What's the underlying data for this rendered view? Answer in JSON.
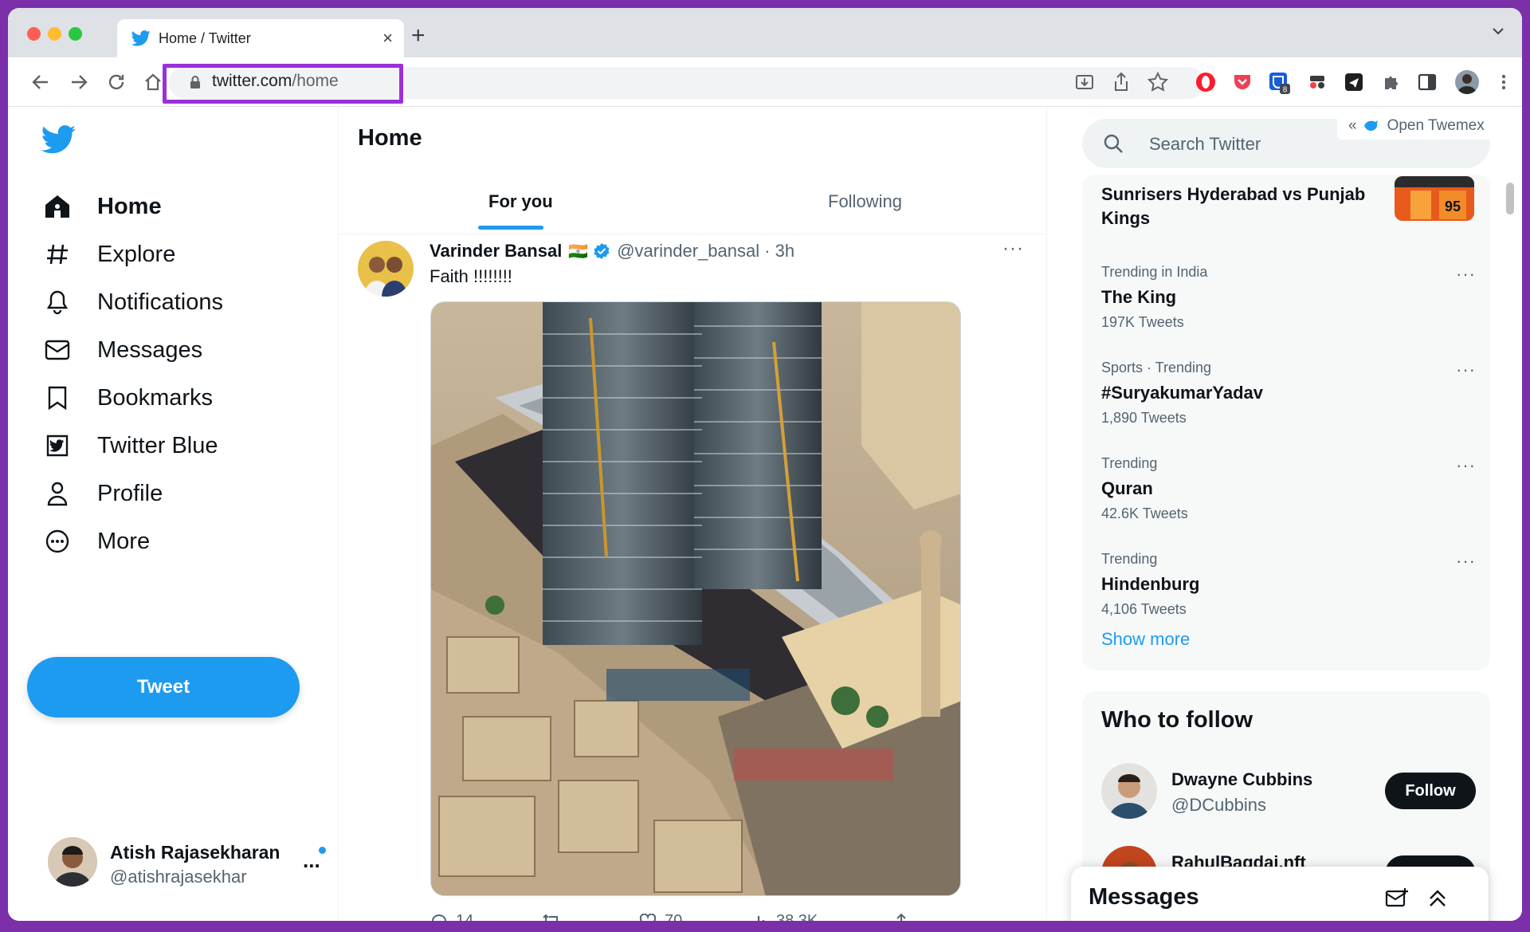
{
  "browser": {
    "tab_title": "Home / Twitter",
    "tab_close": "×",
    "new_tab": "+",
    "url_host": "twitter.com",
    "url_path": "/home",
    "extension_badge": "8"
  },
  "nav": {
    "items": [
      {
        "label": "Home",
        "icon": "home-icon",
        "active": true
      },
      {
        "label": "Explore",
        "icon": "hashtag-icon"
      },
      {
        "label": "Notifications",
        "icon": "bell-icon"
      },
      {
        "label": "Messages",
        "icon": "envelope-icon"
      },
      {
        "label": "Bookmarks",
        "icon": "bookmark-icon"
      },
      {
        "label": "Twitter Blue",
        "icon": "twitter-blue-icon"
      },
      {
        "label": "Profile",
        "icon": "person-icon"
      },
      {
        "label": "More",
        "icon": "more-circle-icon"
      }
    ],
    "tweet_button": "Tweet"
  },
  "account": {
    "name": "Atish Rajasekharan",
    "handle": "@atishrajasekhar",
    "more": "..."
  },
  "main": {
    "title": "Home",
    "tabs": [
      {
        "label": "For you",
        "active": true
      },
      {
        "label": "Following"
      }
    ]
  },
  "tweet": {
    "author": "Varinder Bansal",
    "flag": "🇮🇳",
    "handle_time": "@varinder_bansal · 3h",
    "more": "···",
    "text": "Faith !!!!!!!!",
    "replies": "14",
    "likes": "70",
    "views": "38.3K"
  },
  "sidebar": {
    "search_placeholder": "Search Twitter",
    "twemex": "Open Twemex",
    "twemex_chevrons": "«",
    "top_trend_partial": "Sunrisers Hyderabad vs Punjab Kings",
    "trends": [
      {
        "context": "Trending in India",
        "topic": "The King",
        "count": "197K Tweets"
      },
      {
        "context": "Sports · Trending",
        "topic": "#SuryakumarYadav",
        "count": "1,890 Tweets"
      },
      {
        "context": "Trending",
        "topic": "Quran",
        "count": "42.6K Tweets"
      },
      {
        "context": "Trending",
        "topic": "Hindenburg",
        "count": "4,106 Tweets"
      }
    ],
    "trend_more": "···",
    "show_more": "Show more",
    "who_to_follow": "Who to follow",
    "follow_suggestions": [
      {
        "name": "Dwayne Cubbins",
        "handle": "@DCubbins",
        "button": "Follow"
      },
      {
        "name": "RahulBagdai.nft",
        "handle": "",
        "button": "Follow"
      }
    ]
  },
  "messages_drawer": {
    "title": "Messages"
  },
  "colors": {
    "accent": "#1d9bf0",
    "highlight": "#9b30d9",
    "frame": "#7b2fa8"
  }
}
